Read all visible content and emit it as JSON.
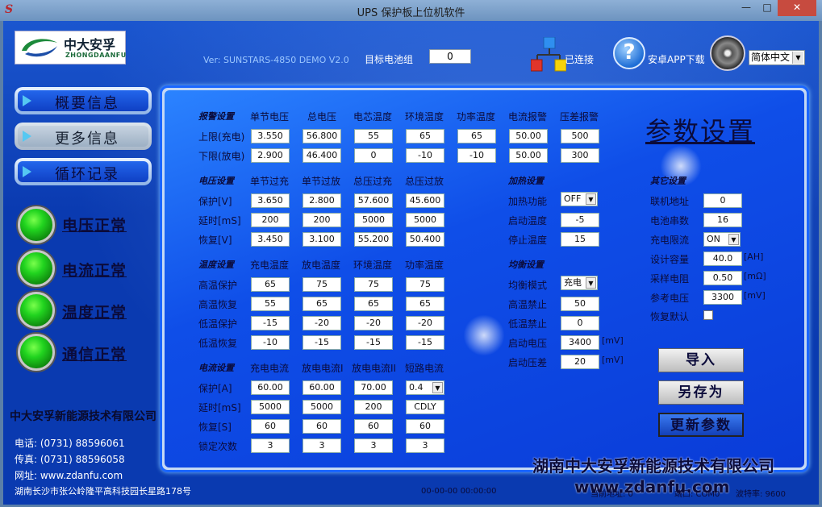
{
  "window": {
    "title": "UPS 保护板上位机软件",
    "app_icon": "S",
    "min": "—",
    "max": "□",
    "close": "✕"
  },
  "header": {
    "logo_name": "中大安孚",
    "logo_sub": "ZHONGDAANFU",
    "version": "Ver: SUNSTARS-4850 DEMO V2.0",
    "target_label": "目标电池组",
    "target_value": "0",
    "connected": "已连接",
    "app_download": "安卓APP下载",
    "language": "简体中文"
  },
  "nav": [
    {
      "label": "概要信息"
    },
    {
      "label": "更多信息"
    },
    {
      "label": "循环记录"
    }
  ],
  "status_lights": [
    {
      "label": "电压正常"
    },
    {
      "label": "电流正常"
    },
    {
      "label": "温度正常"
    },
    {
      "label": "通信正常"
    }
  ],
  "company": {
    "name": "中大安孚新能源技术有限公司",
    "phone": "电话: (0731) 88596061",
    "fax": "传真: (0731) 88596058",
    "web": "网址: www.zdanfu.com",
    "address": "湖南长沙市张公岭隆平高科技园长星路178号",
    "name_large": "湖南中大安孚新能源技术有限公司",
    "website_large": "www.zdanfu.com"
  },
  "page_title": "参数设置",
  "alarm": {
    "section": "报警设置",
    "headers": [
      "单节电压",
      "总电压",
      "电芯温度",
      "环境温度",
      "功率温度",
      "电流报警",
      "压差报警"
    ],
    "rows": [
      {
        "label": "上限(充电)",
        "values": [
          "3.550",
          "56.800",
          "55",
          "65",
          "65",
          "50.00",
          "500"
        ]
      },
      {
        "label": "下限(放电)",
        "values": [
          "2.900",
          "46.400",
          "0",
          "-10",
          "-10",
          "50.00",
          "300"
        ]
      }
    ]
  },
  "voltage": {
    "section": "电压设置",
    "headers": [
      "单节过充",
      "单节过放",
      "总压过充",
      "总压过放"
    ],
    "rows": [
      {
        "label": "保护[V]",
        "values": [
          "3.650",
          "2.800",
          "57.600",
          "45.600"
        ]
      },
      {
        "label": "延时[mS]",
        "values": [
          "200",
          "200",
          "5000",
          "5000"
        ]
      },
      {
        "label": "恢复[V]",
        "values": [
          "3.450",
          "3.100",
          "55.200",
          "50.400"
        ]
      }
    ]
  },
  "temperature": {
    "section": "温度设置",
    "headers": [
      "充电温度",
      "放电温度",
      "环境温度",
      "功率温度"
    ],
    "rows": [
      {
        "label": "高温保护",
        "values": [
          "65",
          "75",
          "75",
          "75"
        ]
      },
      {
        "label": "高温恢复",
        "values": [
          "55",
          "65",
          "65",
          "65"
        ]
      },
      {
        "label": "低温保护",
        "values": [
          "-15",
          "-20",
          "-20",
          "-20"
        ]
      },
      {
        "label": "低温恢复",
        "values": [
          "-10",
          "-15",
          "-15",
          "-15"
        ]
      }
    ]
  },
  "current": {
    "section": "电流设置",
    "headers": [
      "充电电流",
      "放电电流I",
      "放电电流II",
      "短路电流"
    ],
    "rows": [
      {
        "label": "保护[A]",
        "values": [
          "60.00",
          "60.00",
          "70.00",
          "0.4"
        ]
      },
      {
        "label": "延时[mS]",
        "values": [
          "5000",
          "5000",
          "200",
          "CDLY"
        ]
      },
      {
        "label": "恢复[S]",
        "values": [
          "60",
          "60",
          "60",
          "60"
        ]
      },
      {
        "label": "锁定次数",
        "values": [
          "3",
          "3",
          "3",
          "3"
        ]
      }
    ]
  },
  "heating": {
    "section": "加热设置",
    "rows": [
      {
        "label": "加热功能",
        "value": "OFF"
      },
      {
        "label": "启动温度",
        "value": "-5"
      },
      {
        "label": "停止温度",
        "value": "15"
      }
    ]
  },
  "balance": {
    "section": "均衡设置",
    "rows": [
      {
        "label": "均衡模式",
        "value": "充电",
        "unit": ""
      },
      {
        "label": "高温禁止",
        "value": "50",
        "unit": ""
      },
      {
        "label": "低温禁止",
        "value": "0",
        "unit": ""
      },
      {
        "label": "启动电压",
        "value": "3400",
        "unit": "[mV]"
      },
      {
        "label": "启动压差",
        "value": "20",
        "unit": "[mV]"
      }
    ]
  },
  "other": {
    "section": "其它设置",
    "rows": [
      {
        "label": "联机地址",
        "value": "0",
        "unit": ""
      },
      {
        "label": "电池串数",
        "value": "16",
        "unit": ""
      },
      {
        "label": "充电限流",
        "value": "ON",
        "unit": ""
      },
      {
        "label": "设计容量",
        "value": "40.0",
        "unit": "[AH]"
      },
      {
        "label": "采样电阻",
        "value": "0.50",
        "unit": "[mΩ]"
      },
      {
        "label": "参考电压",
        "value": "3300",
        "unit": "[mV]"
      },
      {
        "label": "恢复默认",
        "value": "",
        "unit": ""
      }
    ]
  },
  "actions": {
    "import": "导入",
    "save_as": "另存为",
    "update": "更新参数"
  },
  "statusbar": {
    "datetime": "00-00-00 00:00:00",
    "addr": "当前地址: 0",
    "port": "端口: COM0",
    "baud": "波特率: 9600"
  }
}
